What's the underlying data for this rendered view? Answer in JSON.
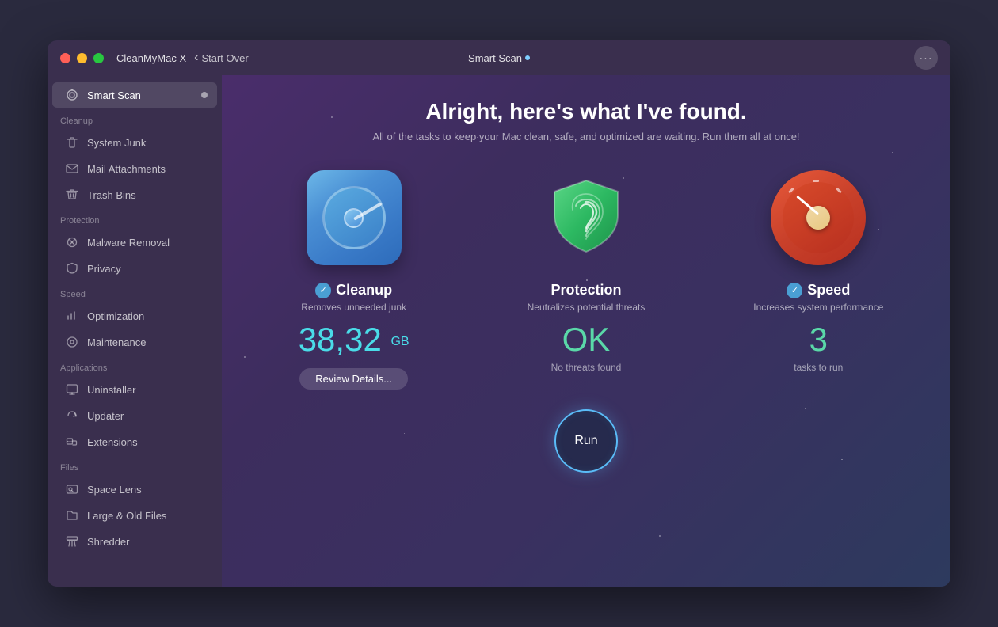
{
  "window": {
    "title": "CleanMyMac X",
    "nav_back": "Start Over",
    "center_title": "Smart Scan",
    "more_icon": "···"
  },
  "traffic_lights": {
    "red": "#ff5f57",
    "yellow": "#febc2e",
    "green": "#28c840"
  },
  "sidebar": {
    "active_item": "Smart Scan",
    "items": [
      {
        "label": "Smart Scan",
        "section": null,
        "active": true
      },
      {
        "label": "Cleanup",
        "section": "Cleanup",
        "is_section": true
      },
      {
        "label": "System Junk",
        "section": "Cleanup"
      },
      {
        "label": "Mail Attachments",
        "section": "Cleanup"
      },
      {
        "label": "Trash Bins",
        "section": "Cleanup"
      },
      {
        "label": "Protection",
        "section": "Protection",
        "is_section": true
      },
      {
        "label": "Malware Removal",
        "section": "Protection"
      },
      {
        "label": "Privacy",
        "section": "Protection"
      },
      {
        "label": "Speed",
        "section": "Speed",
        "is_section": true
      },
      {
        "label": "Optimization",
        "section": "Speed"
      },
      {
        "label": "Maintenance",
        "section": "Speed"
      },
      {
        "label": "Applications",
        "section": "Applications",
        "is_section": true
      },
      {
        "label": "Uninstaller",
        "section": "Applications"
      },
      {
        "label": "Updater",
        "section": "Applications"
      },
      {
        "label": "Extensions",
        "section": "Applications"
      },
      {
        "label": "Files",
        "section": "Files",
        "is_section": true
      },
      {
        "label": "Space Lens",
        "section": "Files"
      },
      {
        "label": "Large & Old Files",
        "section": "Files"
      },
      {
        "label": "Shredder",
        "section": "Files"
      }
    ]
  },
  "content": {
    "headline": "Alright, here's what I've found.",
    "subheadline": "All of the tasks to keep your Mac clean, safe, and optimized are waiting. Run them all at once!",
    "cards": [
      {
        "id": "cleanup",
        "title": "Cleanup",
        "subtitle": "Removes unneeded junk",
        "value": "38,32",
        "unit": "GB",
        "note": "",
        "has_check": true,
        "has_review": true,
        "review_label": "Review Details..."
      },
      {
        "id": "protection",
        "title": "Protection",
        "subtitle": "Neutralizes potential threats",
        "value": "OK",
        "unit": "",
        "note": "No threats found",
        "has_check": false,
        "has_review": false,
        "review_label": ""
      },
      {
        "id": "speed",
        "title": "Speed",
        "subtitle": "Increases system performance",
        "value": "3",
        "unit": "",
        "note": "tasks to run",
        "has_check": true,
        "has_review": false,
        "review_label": ""
      }
    ],
    "run_button": "Run"
  }
}
